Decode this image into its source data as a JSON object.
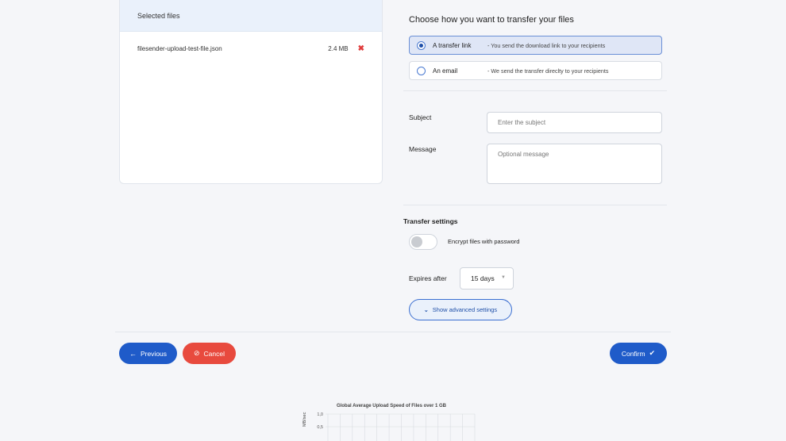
{
  "files_panel": {
    "header": "Selected files",
    "files": [
      {
        "name": "filesender-upload-test-file.json",
        "size": "2.4 MB",
        "remove_icon": "close-icon"
      }
    ]
  },
  "transfer": {
    "title": "Choose how you want to transfer your files",
    "options": [
      {
        "label": "A transfer link",
        "description": "- You send the download link to your recipients",
        "selected": true
      },
      {
        "label": "An email",
        "description": "- We send the transfer direclty to your recipients",
        "selected": false
      }
    ]
  },
  "form": {
    "subject_label": "Subject",
    "subject_placeholder": "Enter the subject",
    "message_label": "Message",
    "message_placeholder": "Optional message"
  },
  "settings": {
    "title": "Transfer settings",
    "encrypt_label": "Encrypt files with password",
    "encrypt_enabled": false,
    "expires_label": "Expires after",
    "expires_value": "15 days",
    "advanced_label": "Show advanced settings"
  },
  "actions": {
    "previous_label": "Previous",
    "cancel_label": "Cancel",
    "confirm_label": "Confirm"
  },
  "colors": {
    "primary": "#1f5bc9",
    "danger": "#e84a3e",
    "selected_bg": "#dfe6f6"
  },
  "chart_data": {
    "type": "line",
    "title": "Global Average Upload Speed of Files over 1 GB",
    "ylabel": "MB/sec",
    "y_ticks": [
      "1,0",
      "0,5"
    ],
    "grid": true,
    "series": []
  }
}
